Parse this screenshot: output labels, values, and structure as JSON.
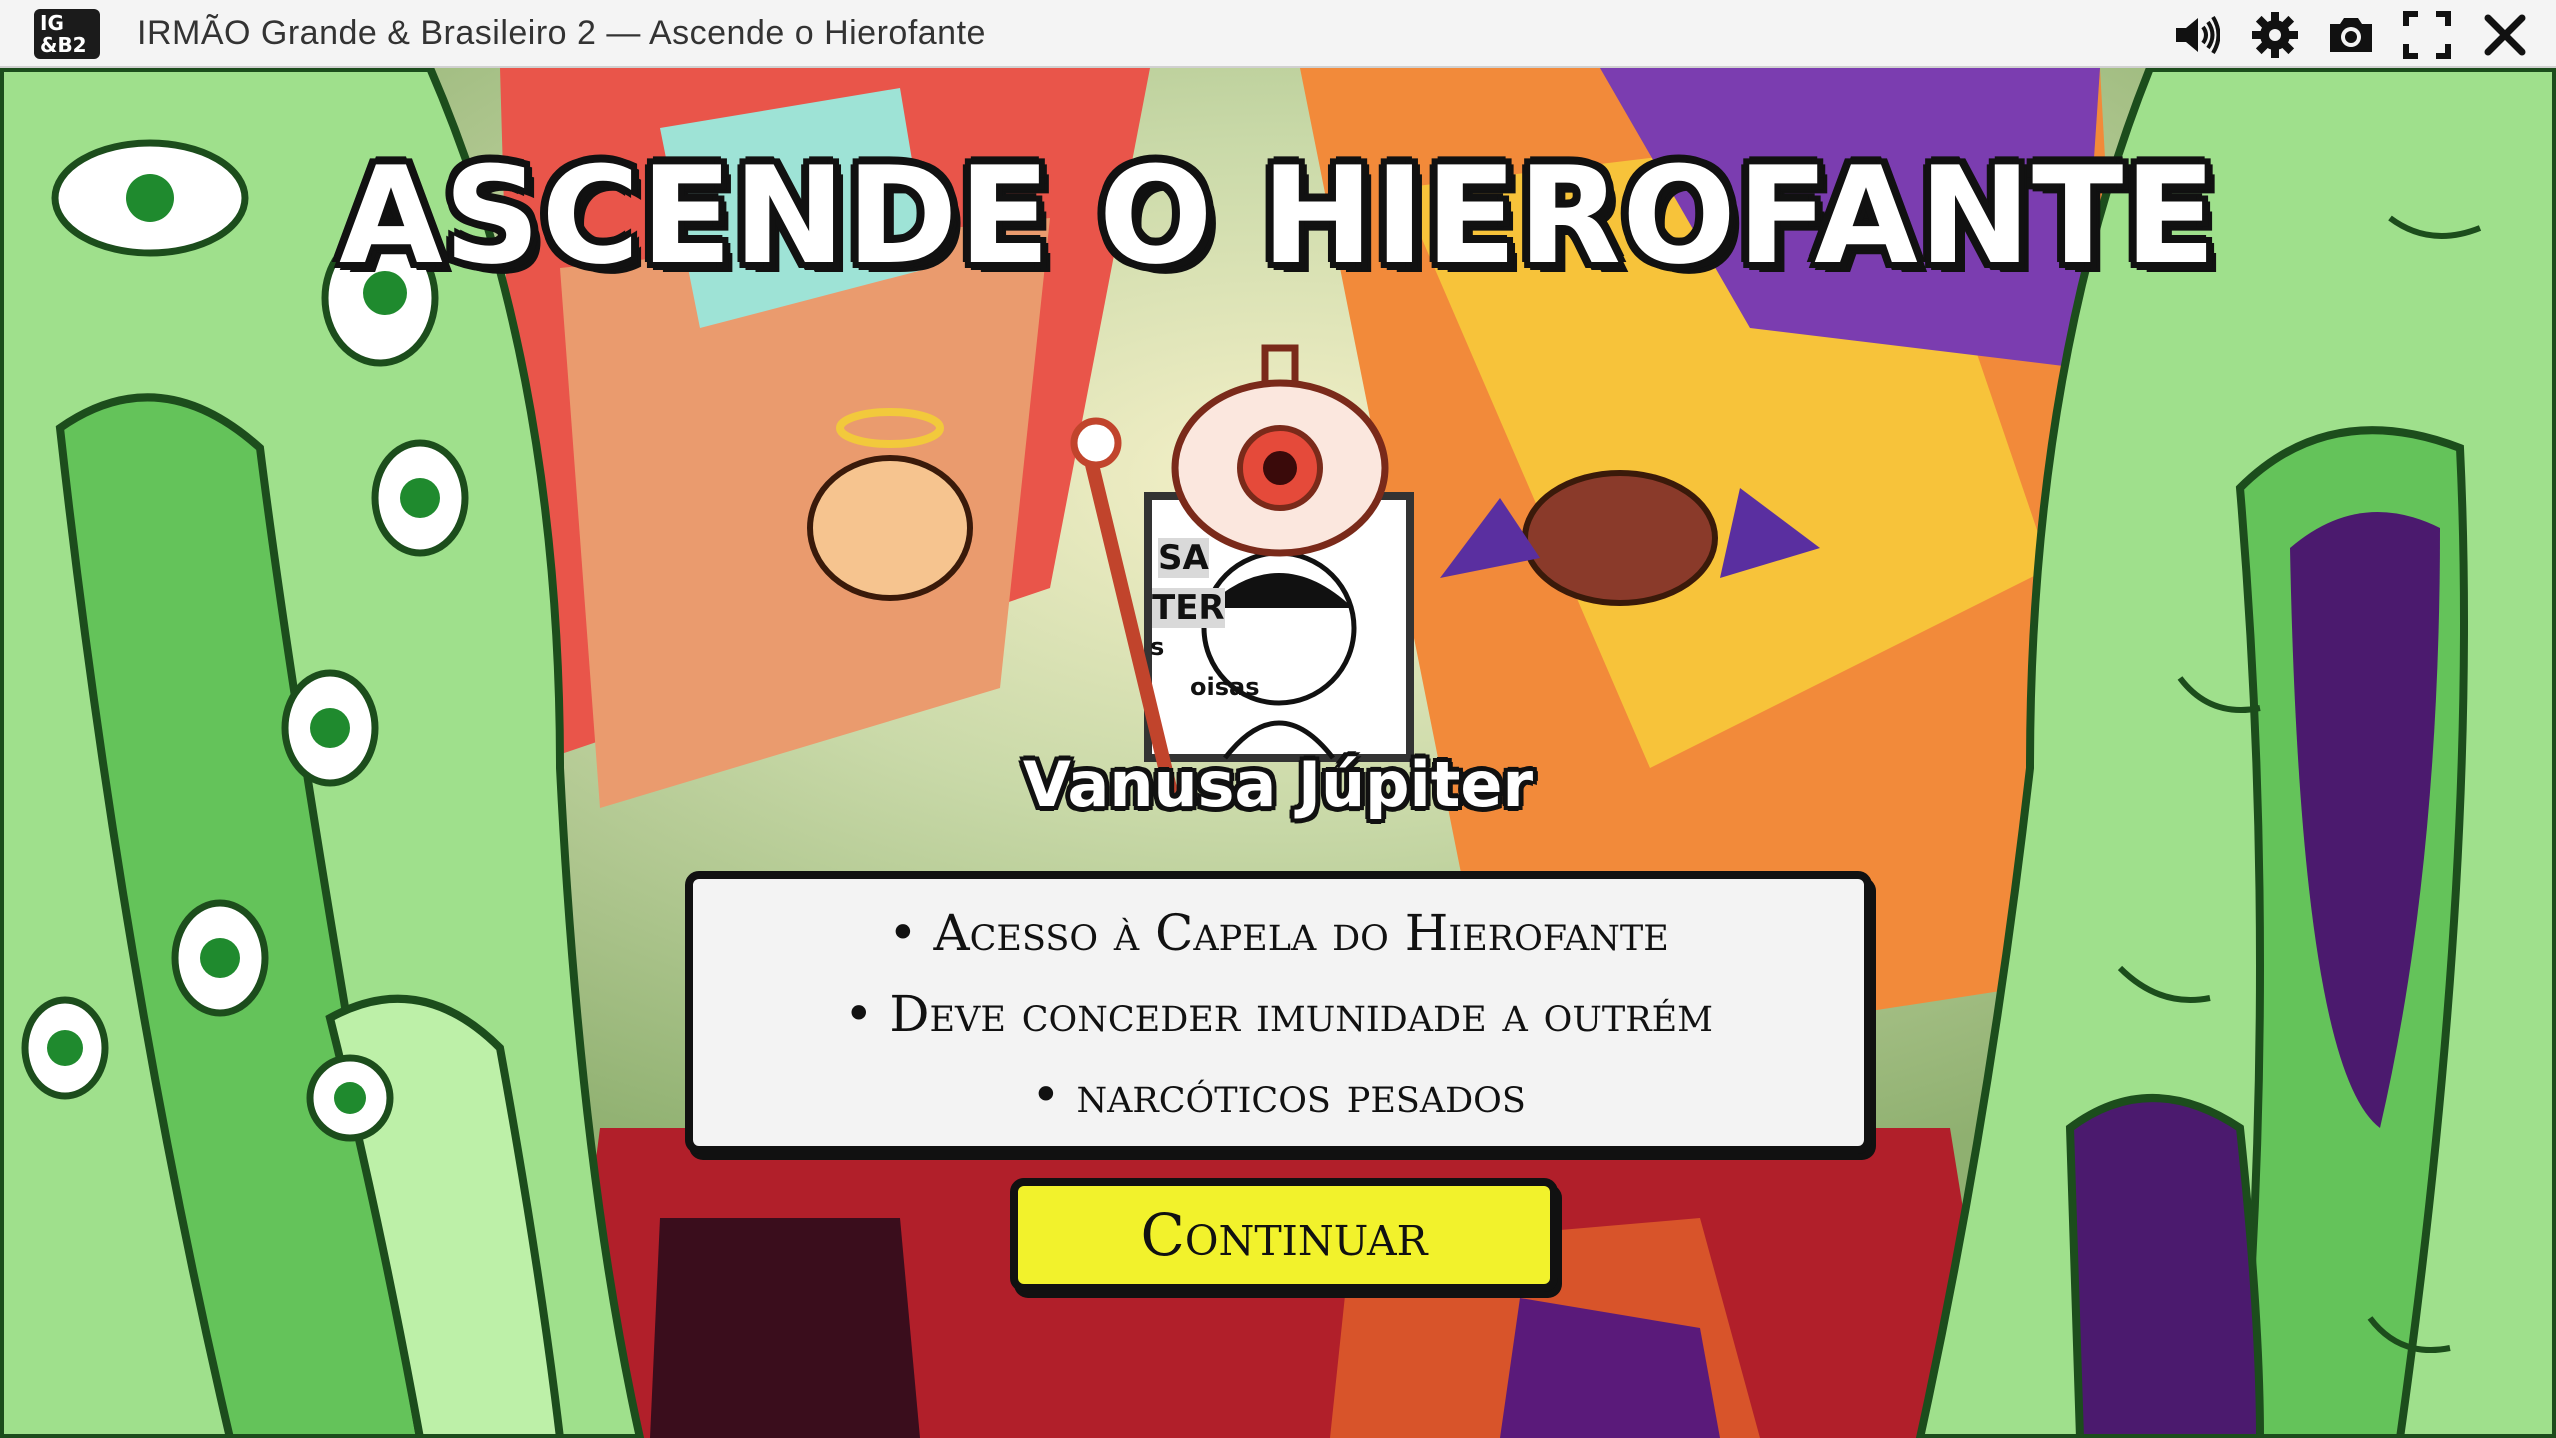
{
  "window": {
    "logo_text": "IG&B2",
    "title": "IRMÃO Grande & Brasileiro 2 — Ascende o Hierofante",
    "toolbar_icons": [
      "volume-icon",
      "settings-gear-icon",
      "screenshot-camera-icon",
      "fullscreen-icon",
      "close-icon"
    ]
  },
  "game": {
    "title": "ASCENDE O HIEROFANTE",
    "character_name": "Vanusa Júpiter",
    "portrait_text": [
      "SA",
      "TER",
      "s",
      "oisas"
    ],
    "perks": [
      "• Acesso à Capela do Hierofante",
      "• Deve conceder imunidade a outrém",
      "• narcóticos pesados"
    ],
    "continue_label": "Continuar"
  },
  "colors": {
    "accent_button": "#f2f22c",
    "creature_green": "#9fe08c",
    "outline": "#111111"
  }
}
